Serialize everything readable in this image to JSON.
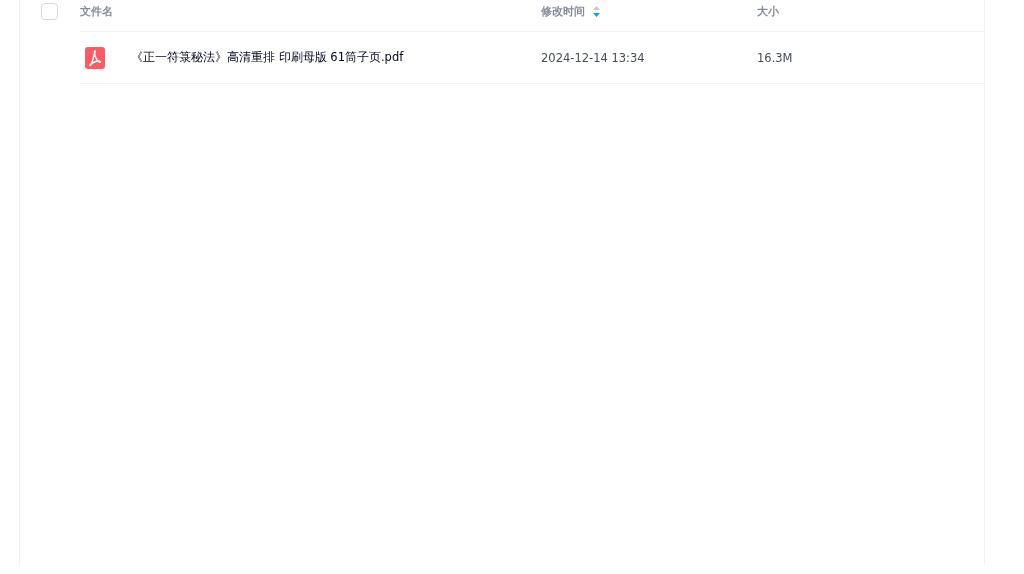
{
  "table": {
    "select_all": {
      "checked": false
    },
    "sort_descending": true,
    "columns": [
      {
        "label": "文件名",
        "sorted": false
      },
      {
        "label": "修改时间",
        "sorted": true
      },
      {
        "label": "大小",
        "sorted": false
      }
    ],
    "rows": [
      {
        "kind": "pdf",
        "name": "《正一符箓秘法》高清重排 印刷母版 61筒子页.pdf",
        "modified": "2024-12-14 13:34",
        "size": "16.3M"
      }
    ]
  }
}
